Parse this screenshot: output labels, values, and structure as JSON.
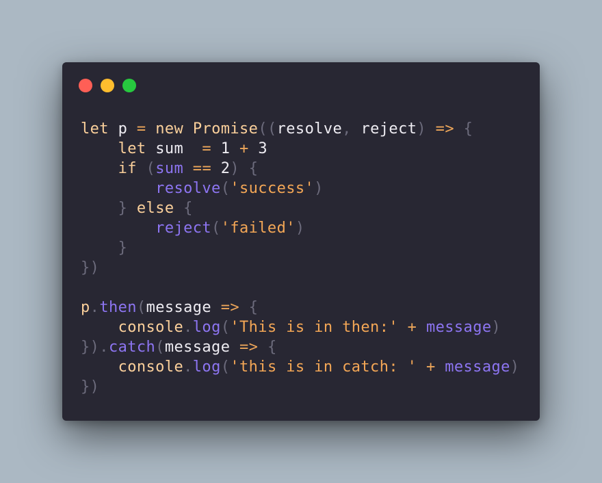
{
  "window": {
    "controls": [
      {
        "name": "close",
        "color": "#ff5f56"
      },
      {
        "name": "minimize",
        "color": "#ffbd2e"
      },
      {
        "name": "maximize",
        "color": "#27c93f"
      }
    ]
  },
  "code": {
    "lines": [
      [
        {
          "t": "let",
          "c": "kw"
        },
        {
          "t": " ",
          "c": "id"
        },
        {
          "t": "p",
          "c": "id"
        },
        {
          "t": " ",
          "c": "id"
        },
        {
          "t": "=",
          "c": "op"
        },
        {
          "t": " ",
          "c": "id"
        },
        {
          "t": "new",
          "c": "kw"
        },
        {
          "t": " ",
          "c": "id"
        },
        {
          "t": "Promise",
          "c": "kw"
        },
        {
          "t": "((",
          "c": "punc"
        },
        {
          "t": "resolve",
          "c": "id"
        },
        {
          "t": ",",
          "c": "punc"
        },
        {
          "t": " ",
          "c": "id"
        },
        {
          "t": "reject",
          "c": "id"
        },
        {
          "t": ")",
          "c": "punc"
        },
        {
          "t": " ",
          "c": "id"
        },
        {
          "t": "=>",
          "c": "op"
        },
        {
          "t": " ",
          "c": "id"
        },
        {
          "t": "{",
          "c": "punc"
        }
      ],
      [
        {
          "t": "    ",
          "c": "id"
        },
        {
          "t": "let",
          "c": "kw"
        },
        {
          "t": " ",
          "c": "id"
        },
        {
          "t": "sum",
          "c": "id"
        },
        {
          "t": "  ",
          "c": "id"
        },
        {
          "t": "=",
          "c": "op"
        },
        {
          "t": " ",
          "c": "id"
        },
        {
          "t": "1",
          "c": "num"
        },
        {
          "t": " ",
          "c": "id"
        },
        {
          "t": "+",
          "c": "op"
        },
        {
          "t": " ",
          "c": "id"
        },
        {
          "t": "3",
          "c": "num"
        }
      ],
      [
        {
          "t": "    ",
          "c": "id"
        },
        {
          "t": "if",
          "c": "kw"
        },
        {
          "t": " ",
          "c": "id"
        },
        {
          "t": "(",
          "c": "punc"
        },
        {
          "t": "sum",
          "c": "fn"
        },
        {
          "t": " ",
          "c": "id"
        },
        {
          "t": "==",
          "c": "op"
        },
        {
          "t": " ",
          "c": "id"
        },
        {
          "t": "2",
          "c": "num"
        },
        {
          "t": ")",
          "c": "punc"
        },
        {
          "t": " ",
          "c": "id"
        },
        {
          "t": "{",
          "c": "punc"
        }
      ],
      [
        {
          "t": "        ",
          "c": "id"
        },
        {
          "t": "resolve",
          "c": "fn"
        },
        {
          "t": "(",
          "c": "punc"
        },
        {
          "t": "'success'",
          "c": "str"
        },
        {
          "t": ")",
          "c": "punc"
        }
      ],
      [
        {
          "t": "    ",
          "c": "id"
        },
        {
          "t": "}",
          "c": "punc"
        },
        {
          "t": " ",
          "c": "id"
        },
        {
          "t": "else",
          "c": "kw"
        },
        {
          "t": " ",
          "c": "id"
        },
        {
          "t": "{",
          "c": "punc"
        }
      ],
      [
        {
          "t": "        ",
          "c": "id"
        },
        {
          "t": "reject",
          "c": "fn"
        },
        {
          "t": "(",
          "c": "punc"
        },
        {
          "t": "'failed'",
          "c": "str"
        },
        {
          "t": ")",
          "c": "punc"
        }
      ],
      [
        {
          "t": "    ",
          "c": "id"
        },
        {
          "t": "}",
          "c": "punc"
        }
      ],
      [
        {
          "t": "})",
          "c": "punc"
        }
      ],
      [],
      [
        {
          "t": "p",
          "c": "kw"
        },
        {
          "t": ".",
          "c": "punc"
        },
        {
          "t": "then",
          "c": "fn"
        },
        {
          "t": "(",
          "c": "punc"
        },
        {
          "t": "message",
          "c": "id"
        },
        {
          "t": " ",
          "c": "id"
        },
        {
          "t": "=>",
          "c": "op"
        },
        {
          "t": " ",
          "c": "id"
        },
        {
          "t": "{",
          "c": "punc"
        }
      ],
      [
        {
          "t": "    ",
          "c": "id"
        },
        {
          "t": "console",
          "c": "kw"
        },
        {
          "t": ".",
          "c": "punc"
        },
        {
          "t": "log",
          "c": "fn"
        },
        {
          "t": "(",
          "c": "punc"
        },
        {
          "t": "'This is in then:'",
          "c": "str"
        },
        {
          "t": " ",
          "c": "id"
        },
        {
          "t": "+",
          "c": "op"
        },
        {
          "t": " ",
          "c": "id"
        },
        {
          "t": "message",
          "c": "fn"
        },
        {
          "t": ")",
          "c": "punc"
        }
      ],
      [
        {
          "t": "}).",
          "c": "punc"
        },
        {
          "t": "catch",
          "c": "fn"
        },
        {
          "t": "(",
          "c": "punc"
        },
        {
          "t": "message",
          "c": "id"
        },
        {
          "t": " ",
          "c": "id"
        },
        {
          "t": "=>",
          "c": "op"
        },
        {
          "t": " ",
          "c": "id"
        },
        {
          "t": "{",
          "c": "punc"
        }
      ],
      [
        {
          "t": "    ",
          "c": "id"
        },
        {
          "t": "console",
          "c": "kw"
        },
        {
          "t": ".",
          "c": "punc"
        },
        {
          "t": "log",
          "c": "fn"
        },
        {
          "t": "(",
          "c": "punc"
        },
        {
          "t": "'this is in catch: '",
          "c": "str"
        },
        {
          "t": " ",
          "c": "id"
        },
        {
          "t": "+",
          "c": "op"
        },
        {
          "t": " ",
          "c": "id"
        },
        {
          "t": "message",
          "c": "fn"
        },
        {
          "t": ")",
          "c": "punc"
        }
      ],
      [
        {
          "t": "})",
          "c": "punc"
        }
      ]
    ]
  }
}
